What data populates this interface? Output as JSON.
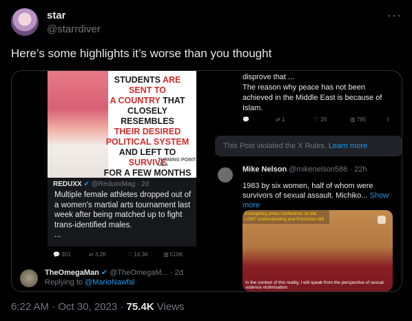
{
  "author": {
    "name": "star",
    "handle": "@starrdiver"
  },
  "post": {
    "text": "Here’s some highlights it’s worse than you thought"
  },
  "media": {
    "meme": {
      "line1a": "STUDENTS ",
      "line1b": "ARE SENT TO",
      "line2": "A COUNTRY",
      "line2b": " THAT",
      "line3": "CLOSELY RESEMBLES",
      "line4": "THEIR DESIRED",
      "line5": "POLITICAL SYSTEM",
      "line6a": "AND LEFT TO ",
      "line6b": "SURVIVE",
      "line7": "FOR A FEW MONTHS",
      "logo": "TURNING POINT USA"
    },
    "quoted": {
      "source_name": "REDUXX",
      "source_handle": "@ReduxxMag · 2d",
      "text": "Multiple female athletes dropped out of a women's martial arts tournament last week after being matched up to fight trans-identified males.",
      "ellipsis": "...",
      "stats": {
        "replies": "301",
        "retweets": "3.2K",
        "likes": "16.3K",
        "views": "510K"
      }
    },
    "reply": {
      "name": "TheOmegaMan",
      "handle": "@TheOmegaM... · 2d",
      "replying_label": "Replying to ",
      "replying_to": "@MarioNawfal"
    },
    "right": {
      "text_top": "disprove that ...\nThe reason why peace has not been achieved in the Middle East is because of Islam.",
      "stats": {
        "replies": "",
        "retweets": "1",
        "likes": "26",
        "views": "795"
      },
      "violated_text": "This Post violated the X Rules. ",
      "violated_link": "Learn more",
      "mike_name": "Mike Nelson",
      "mike_handle": "@mikenelson586 · 22h",
      "mike_text": "1983 by six women, half of whom were survivors of sexual assault. Michiko...",
      "show_more": " Show more",
      "conf_banner": "Emergency press conference on the LGBT Understanding and Promotion Bill",
      "conf_caption": "In the context of this reality, I will speak from the perspective of sexual violence victimisation."
    }
  },
  "footer": {
    "time": "6:22 AM · Oct 30, 2023 · ",
    "views_count": "75.4K",
    "views_label": " Views"
  }
}
